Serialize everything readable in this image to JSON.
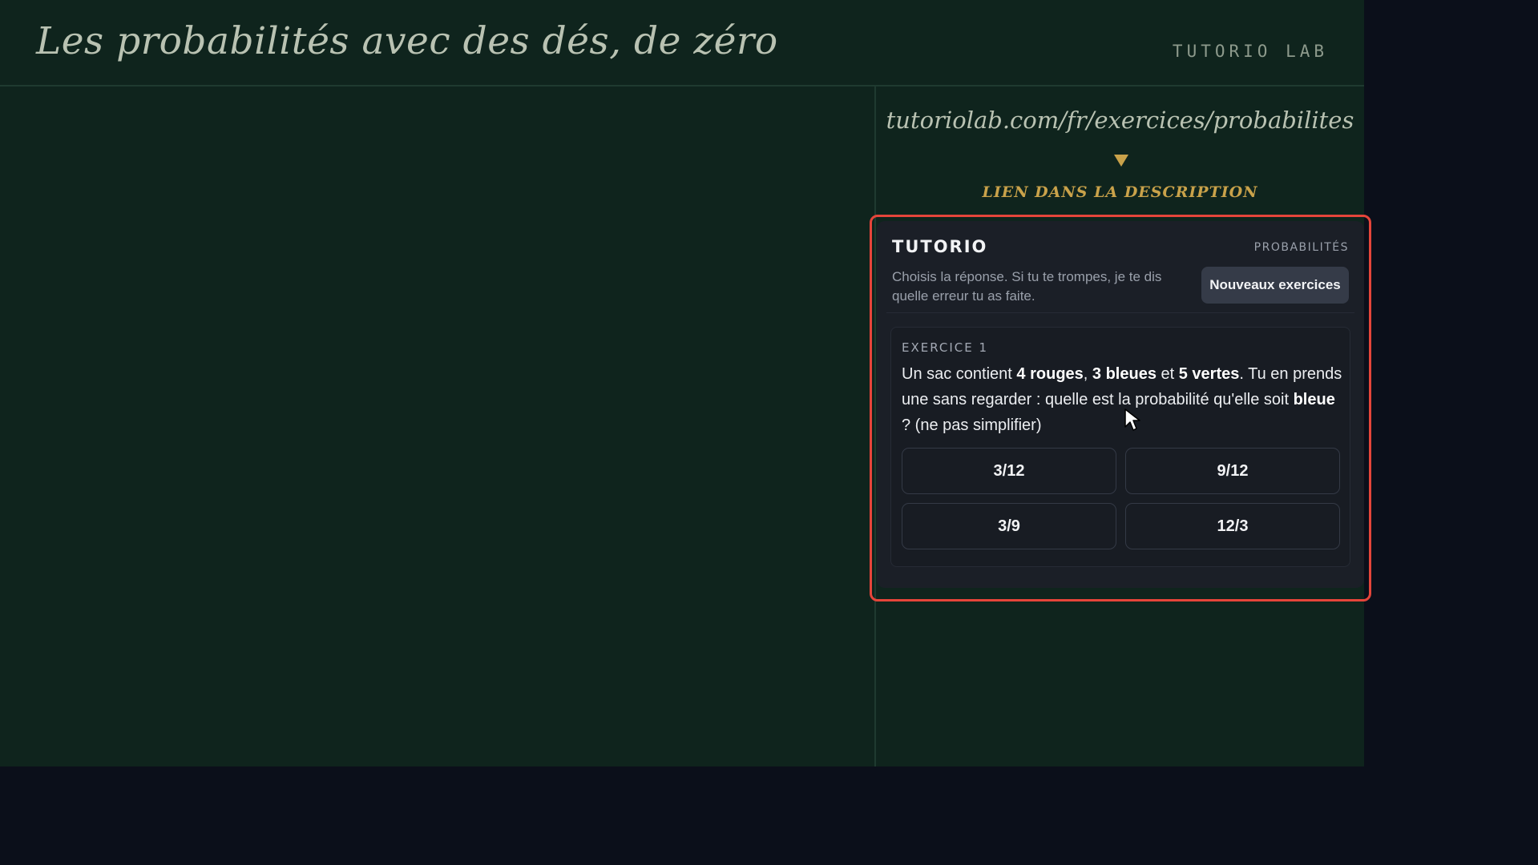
{
  "header": {
    "title": "Les probabilités avec des dés, de zéro",
    "brand": "TUTORIO LAB"
  },
  "promo": {
    "url": "tutoriolab.com/fr/exercices/probabilites",
    "link_note": "LIEN DANS LA DESCRIPTION"
  },
  "widget": {
    "title": "TUTORIO",
    "tag": "PROBABILITÉS",
    "subtitle": "Choisis la réponse. Si tu te trompes, je te dis quelle erreur tu as faite.",
    "new_button": "Nouveaux exercices",
    "exercise": {
      "label": "EXERCICE 1",
      "question": {
        "t1": "Un sac contient ",
        "b1": "4 rouges",
        "t2": ", ",
        "b2": "3 bleues",
        "t3": " et ",
        "b3": "5 vertes",
        "t4": ". Tu en prends une sans regarder : quelle est la probabilité qu'elle soit ",
        "b4": "bleue",
        "t5": " ? (ne pas simplifier)"
      },
      "choices": [
        "3/12",
        "9/12",
        "3/9",
        "12/3"
      ]
    }
  },
  "colors": {
    "board_bg": "#0f241d",
    "outer_bg": "#0b0f1a",
    "accent_gold": "#c9a24a",
    "highlight_red": "#e5453a",
    "widget_bg": "#1b1f27"
  }
}
